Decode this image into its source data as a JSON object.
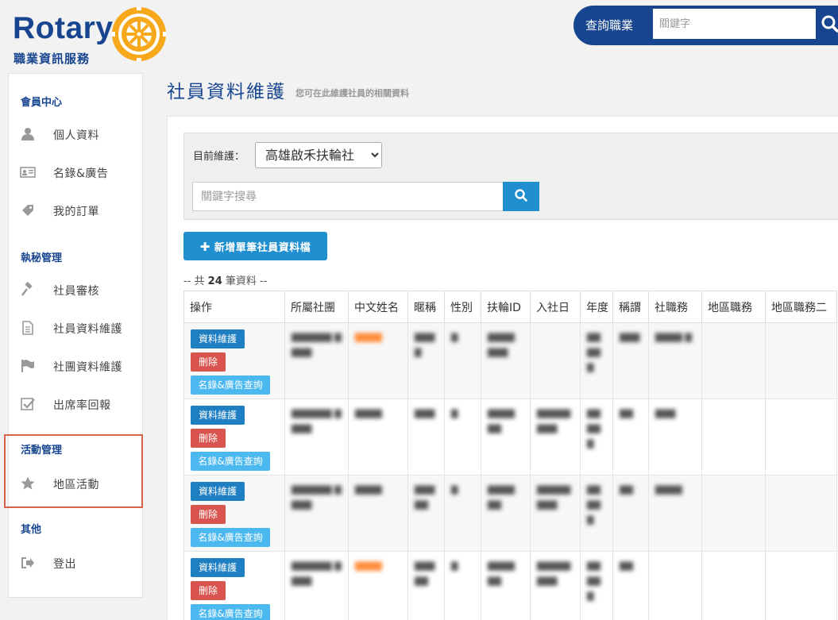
{
  "header": {
    "logo_word": "Rotary",
    "logo_sub": "職業資訊服務",
    "search_label": "查詢職業",
    "search_placeholder": "關鍵字"
  },
  "sidebar": {
    "sections": [
      {
        "title": "會員中心",
        "items": [
          {
            "label": "個人資料",
            "icon": "user-icon"
          },
          {
            "label": "名錄&廣告",
            "icon": "id-card-icon"
          },
          {
            "label": "我的訂單",
            "icon": "tag-icon"
          }
        ]
      },
      {
        "title": "執秘管理",
        "items": [
          {
            "label": "社員審核",
            "icon": "gavel-icon"
          },
          {
            "label": "社員資料維護",
            "icon": "document-icon"
          },
          {
            "label": "社團資料維護",
            "icon": "flag-icon"
          },
          {
            "label": "出席率回報",
            "icon": "check-square-icon"
          }
        ]
      },
      {
        "title": "活動管理",
        "items": [
          {
            "label": "地區活動",
            "icon": "star-icon"
          }
        ]
      },
      {
        "title": "其他",
        "items": [
          {
            "label": "登出",
            "icon": "sign-out-icon"
          }
        ]
      }
    ]
  },
  "page": {
    "title": "社員資料維護",
    "subtitle": "您可在此維護社員的相關資料"
  },
  "filter": {
    "label": "目前維護：",
    "selected_club": "高雄啟禾扶輪社",
    "keyword_placeholder": "關鍵字搜尋"
  },
  "actions": {
    "add_label": "新增單筆社員資料檔"
  },
  "summary": {
    "prefix": "-- 共",
    "count": "24",
    "suffix": "筆資料 --"
  },
  "table": {
    "columns": [
      "操作",
      "所屬社團",
      "中文姓名",
      "暱稱",
      "性別",
      "扶輪ID",
      "入社日",
      "年度",
      "稱謂",
      "社職務",
      "地區職務",
      "地區職務二"
    ],
    "row_buttons": {
      "edit": "資料維護",
      "delete": "刪除",
      "directory": "名錄&廣告查詢"
    },
    "rows": [
      {
        "club": "",
        "name": "",
        "nick": "",
        "gender": "",
        "rid": "",
        "join": "",
        "year": "",
        "title": "",
        "role": ""
      },
      {
        "club": "",
        "name": "",
        "nick": "",
        "gender": "",
        "rid": "",
        "join": "",
        "year": "",
        "title": "",
        "role": ""
      },
      {
        "club": "",
        "name": "",
        "nick": "",
        "gender": "",
        "rid": "",
        "join": "",
        "year": "",
        "title": "",
        "role": ""
      },
      {
        "club": "",
        "name": "",
        "nick": "",
        "gender": "",
        "rid": "",
        "join": "",
        "year": "",
        "title": "",
        "role": ""
      }
    ]
  },
  "colors": {
    "brand": "#17458f",
    "primary_button": "#1f8fd0",
    "danger_button": "#d9534f",
    "info_button": "#4bb8ef",
    "highlight_border": "#d9634a"
  }
}
